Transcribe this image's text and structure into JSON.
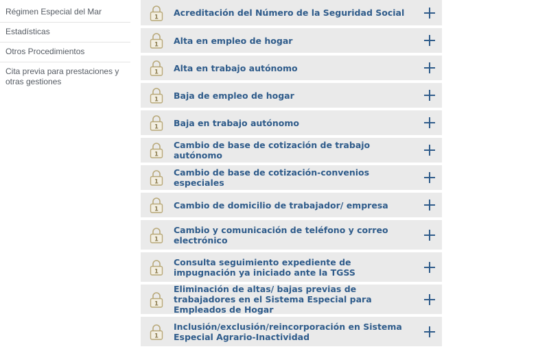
{
  "sidebar": {
    "items": [
      {
        "label": "Régimen Especial del Mar"
      },
      {
        "label": "Estadísticas"
      },
      {
        "label": "Otros Procedimientos"
      },
      {
        "label": "Cita previa para prestaciones y otras gestiones"
      }
    ]
  },
  "procedures": {
    "lock_icon": "lock-icon",
    "expand_icon": "plus-icon",
    "items": [
      {
        "label": "Acreditación del Número de la Seguridad Social"
      },
      {
        "label": "Alta en empleo de hogar"
      },
      {
        "label": "Alta en trabajo autónomo"
      },
      {
        "label": "Baja de empleo de hogar"
      },
      {
        "label": "Baja en trabajo autónomo"
      },
      {
        "label": "Cambio de base de cotización de trabajo autónomo"
      },
      {
        "label": "Cambio de base de cotización-convenios especiales"
      },
      {
        "label": "Cambio de domicilio de trabajador/ empresa"
      },
      {
        "label": "Cambio y comunicación de teléfono y correo electrónico"
      },
      {
        "label": "Consulta seguimiento expediente de impugnación ya iniciado ante la TGSS"
      },
      {
        "label": "Eliminación de altas/ bajas previas de trabajadores en el Sistema Especial para Empleados de Hogar"
      },
      {
        "label": "Inclusión/exclusión/reincorporación en Sistema Especial Agrario-Inactividad"
      }
    ]
  },
  "colors": {
    "accent": "#2e5b8a",
    "row_bg": "#eaeaea",
    "lock": "#b8a878"
  }
}
